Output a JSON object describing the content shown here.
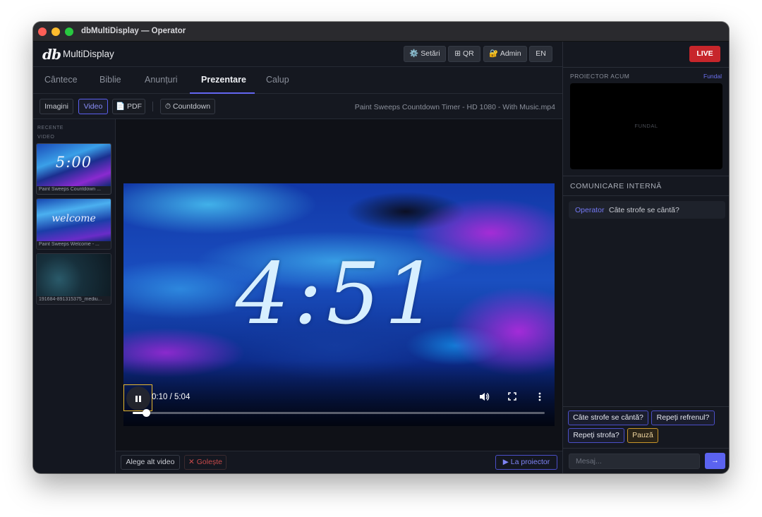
{
  "window": {
    "title": "dbMultiDisplay — Operator"
  },
  "header": {
    "logo": "db",
    "app_name": "MultiDisplay",
    "buttons": [
      {
        "icon": "gear-icon",
        "label": "⚙️ Setări"
      },
      {
        "icon": "qr-icon",
        "label": "⊞ QR"
      },
      {
        "icon": "lock-icon",
        "label": "🔐 Admin"
      },
      {
        "icon": "",
        "label": "EN"
      }
    ],
    "live_label": "LIVE",
    "live_color": "#c7262b"
  },
  "tabs": [
    {
      "label": "Cântece",
      "active": false
    },
    {
      "label": "Biblie",
      "active": false
    },
    {
      "label": "Anunțuri",
      "active": false
    },
    {
      "label": "Prezentare",
      "active": true
    },
    {
      "label": "Calup",
      "active": false
    }
  ],
  "toolbar": {
    "images_label": "Imagini",
    "video_label": "Video",
    "pdf_label": "📄 PDF",
    "countdown_label": "⏱ Countdown",
    "current_file": "Paint Sweeps Countdown Timer - HD 1080 - With Music.mp4"
  },
  "sidebar": {
    "recent_label": "RECENTE",
    "video_label": "VIDEO",
    "items": [
      {
        "caption": "Paint Sweeps Countdown ...",
        "overlay": "5:00"
      },
      {
        "caption": "Paint Sweeps Welcome - ...",
        "overlay": "welcome"
      },
      {
        "caption": "191684-891315375_mediu...",
        "overlay": ""
      }
    ]
  },
  "player": {
    "display_time": "4:51",
    "time_label": "0:10 / 5:04",
    "progress": 0.033
  },
  "bottom": {
    "choose_label": "Alege alt video",
    "clear_label": "✕ Golește",
    "project_label": "▶ La proiector"
  },
  "right": {
    "projector_label": "PROIECTOR ACUM",
    "fundal_link": "Fundal",
    "projector_placeholder": "FUNDAL",
    "comm_label": "COMUNICARE INTERNĂ",
    "messages": [
      {
        "from": "Operator",
        "text": "Câte strofe se cântă?"
      }
    ],
    "quick_replies": [
      "Câte strofe se cântă?",
      "Repeți refrenul?",
      "Repeți strofa?",
      "Pauză"
    ],
    "input_placeholder": "Mesaj...",
    "send_label": "→"
  },
  "colors": {
    "accent": "#6366f1",
    "live": "#c7262b",
    "pause_border": "#c9962a"
  }
}
